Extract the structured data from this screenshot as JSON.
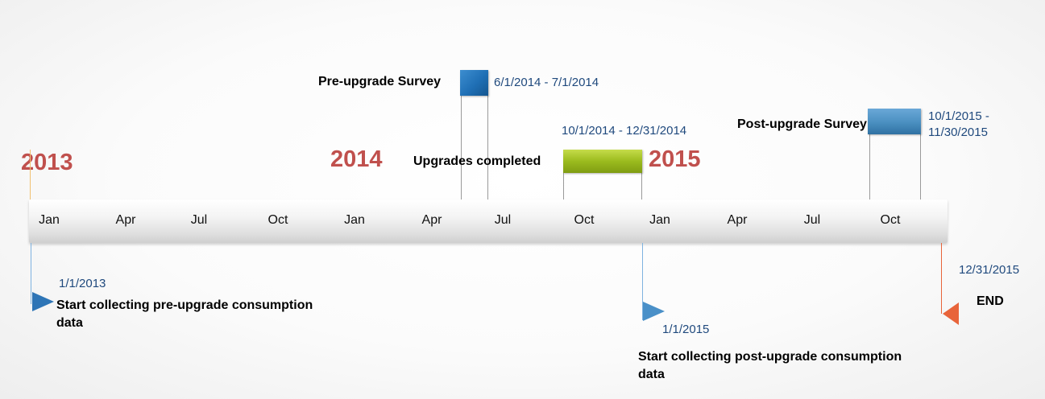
{
  "years": [
    "2013",
    "2014",
    "2015"
  ],
  "months": [
    "Jan",
    "Apr",
    "Jul",
    "Oct",
    "Jan",
    "Apr",
    "Jul",
    "Oct",
    "Jan",
    "Apr",
    "Jul",
    "Oct"
  ],
  "events": {
    "pre_survey": {
      "label": "Pre-upgrade Survey",
      "date": "6/1/2014 - 7/1/2014"
    },
    "upgrades": {
      "label": "Upgrades completed",
      "date": "10/1/2014 - 12/31/2014"
    },
    "post_survey": {
      "label": "Post-upgrade Survey",
      "date_line1": "10/1/2015 -",
      "date_line2": "11/30/2015"
    },
    "start_pre": {
      "date": "1/1/2013",
      "label_line1": "Start collecting pre-upgrade consumption",
      "label_line2": "data"
    },
    "start_post": {
      "date": "1/1/2015",
      "label_line1": "Start collecting post-upgrade consumption",
      "label_line2": "data"
    },
    "end": {
      "date": "12/31/2015",
      "label": "END"
    }
  },
  "colors": {
    "year": "#c0504d",
    "date_text": "#1f497d",
    "pre_survey_box": "#1f6fb5",
    "upgrades_box": "#9bbb1e",
    "post_survey_box": "#4a8fc0",
    "end_flag": "#e8643a",
    "start_flag": "#2e75b6"
  }
}
